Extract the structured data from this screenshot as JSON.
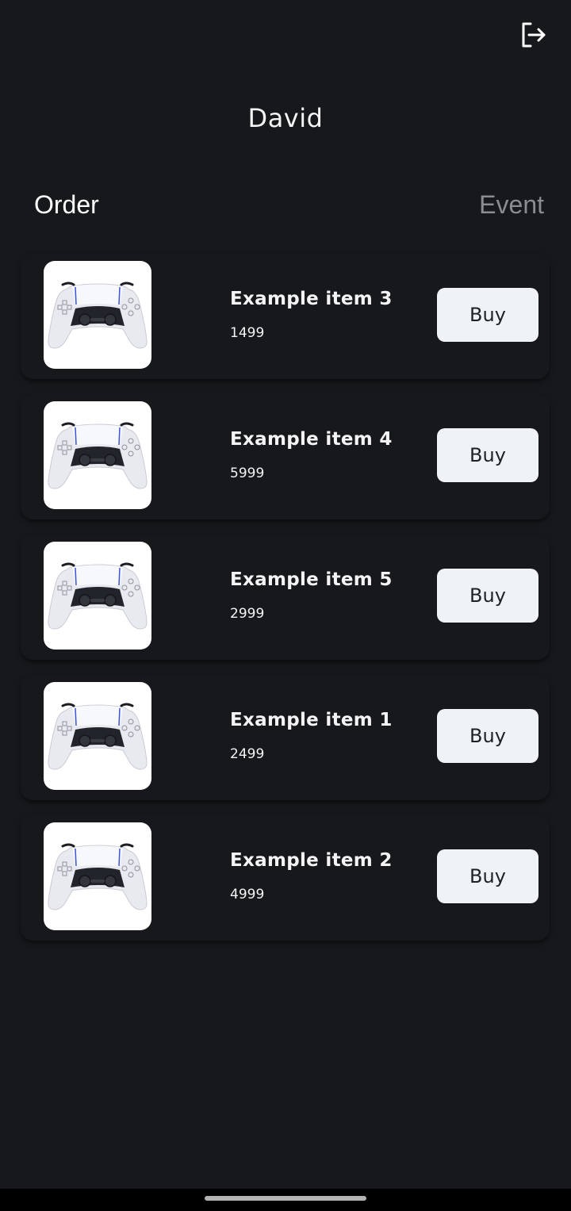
{
  "header": {
    "user_name": "David",
    "logout_icon": "logout-icon"
  },
  "tabs": [
    {
      "label": "Order",
      "active": true
    },
    {
      "label": "Event",
      "active": false
    }
  ],
  "items": [
    {
      "name": "Example item 3",
      "price": "1499",
      "button": "Buy",
      "image": "gamepad-controller-image"
    },
    {
      "name": "Example item 4",
      "price": "5999",
      "button": "Buy",
      "image": "gamepad-controller-image"
    },
    {
      "name": "Example item 5",
      "price": "2999",
      "button": "Buy",
      "image": "gamepad-controller-image"
    },
    {
      "name": "Example item 1",
      "price": "2499",
      "button": "Buy",
      "image": "gamepad-controller-image"
    },
    {
      "name": "Example item 2",
      "price": "4999",
      "button": "Buy",
      "image": "gamepad-controller-image"
    }
  ],
  "colors": {
    "background": "#16181c",
    "button_bg": "#eff2f7",
    "button_text": "#1e2126",
    "inactive_tab": "#8a8c90",
    "controller_accent": "#3b55d8"
  }
}
